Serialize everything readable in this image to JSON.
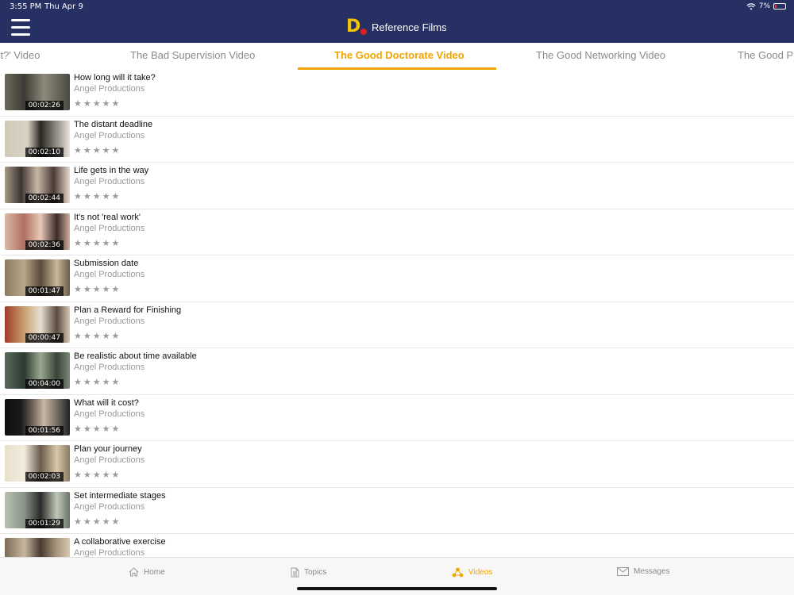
{
  "status": {
    "time": "3:55 PM",
    "date": "Thu Apr 9",
    "battery": "7%"
  },
  "header": {
    "app_title": "Reference Films",
    "logo_text": "D"
  },
  "tabs": [
    {
      "label": "xt?' Video",
      "active": false
    },
    {
      "label": "The Bad Supervision Video",
      "active": false
    },
    {
      "label": "The Good Doctorate Video",
      "active": true
    },
    {
      "label": "The Good Networking Video",
      "active": false
    },
    {
      "label": "The Good Pr",
      "active": false
    }
  ],
  "videos": [
    {
      "title": "How long will it take?",
      "producer": "Angel Productions",
      "duration": "00:02:26",
      "rating": 0
    },
    {
      "title": "The distant deadline",
      "producer": "Angel Productions",
      "duration": "00:02:10",
      "rating": 0
    },
    {
      "title": "Life gets in the way",
      "producer": "Angel Productions",
      "duration": "00:02:44",
      "rating": 0
    },
    {
      "title": "It's not 'real work'",
      "producer": "Angel Productions",
      "duration": "00:02:36",
      "rating": 0
    },
    {
      "title": "Submission date",
      "producer": "Angel Productions",
      "duration": "00:01:47",
      "rating": 0
    },
    {
      "title": "Plan a Reward for Finishing",
      "producer": "Angel Productions",
      "duration": "00:00:47",
      "rating": 0
    },
    {
      "title": "Be realistic about time available",
      "producer": "Angel Productions",
      "duration": "00:04:00",
      "rating": 0
    },
    {
      "title": "What will it cost?",
      "producer": "Angel Productions",
      "duration": "00:01:56",
      "rating": 0
    },
    {
      "title": "Plan your journey",
      "producer": "Angel Productions",
      "duration": "00:02:03",
      "rating": 0
    },
    {
      "title": "Set intermediate stages",
      "producer": "Angel Productions",
      "duration": "00:01:29",
      "rating": 0
    },
    {
      "title": "A collaborative exercise",
      "producer": "Angel Productions",
      "duration": "",
      "rating": 0
    }
  ],
  "stars_glyph": "★★★★★",
  "bottom_nav": [
    {
      "label": "Home",
      "icon": "home-icon",
      "active": false
    },
    {
      "label": "Topics",
      "icon": "document-icon",
      "active": false
    },
    {
      "label": "Videos",
      "icon": "videos-icon",
      "active": true
    },
    {
      "label": "Messages",
      "icon": "envelope-icon",
      "active": false
    }
  ],
  "colors": {
    "header_bg": "#263063",
    "accent": "#f0a500",
    "logo_yellow": "#f5c400",
    "logo_red": "#e02020"
  }
}
